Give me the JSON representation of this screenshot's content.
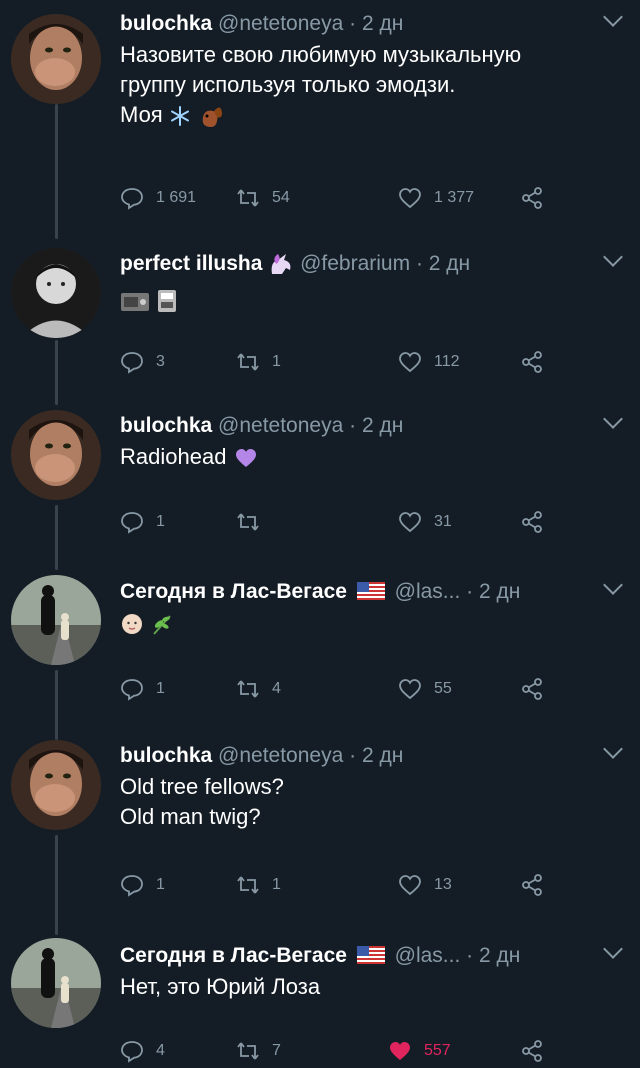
{
  "tweets": [
    {
      "name": "bulochka",
      "handle": "@netetoneya",
      "time": "· 2 дн",
      "lines": [
        "Назовите свою любимую музыкальную",
        "группу используя только эмодзи.",
        "Моя"
      ],
      "replies": "1 691",
      "retweets": "54",
      "likes": "1 377",
      "liked": false
    },
    {
      "name": "perfect illusha",
      "handle": "@febrarium",
      "time": "· 2 дн",
      "lines": [],
      "replies": "3",
      "retweets": "1",
      "likes": "112",
      "liked": false
    },
    {
      "name": "bulochka",
      "handle": "@netetoneya",
      "time": "· 2 дн",
      "lines": [
        "Radiohead"
      ],
      "replies": "1",
      "retweets": "",
      "likes": "31",
      "liked": false
    },
    {
      "name": "Сегодня в Лас-Вегасе",
      "handle": "@las...",
      "time": "· 2 дн",
      "lines": [],
      "replies": "1",
      "retweets": "4",
      "likes": "55",
      "liked": false
    },
    {
      "name": "bulochka",
      "handle": "@netetoneya",
      "time": "· 2 дн",
      "lines": [
        "Old tree fellows?",
        "Old man twig?"
      ],
      "replies": "1",
      "retweets": "1",
      "likes": "13",
      "liked": false
    },
    {
      "name": "Сегодня в Лас-Вегасе",
      "handle": "@las...",
      "time": "· 2 дн",
      "lines": [
        "Нет, это Юрий Лоза"
      ],
      "replies": "4",
      "retweets": "7",
      "likes": "557",
      "liked": true
    }
  ],
  "colors": {
    "background": "#141d26",
    "secondary_text": "#8899a6",
    "like_active": "#e0245e",
    "thread_line": "#38444d"
  },
  "icons": {
    "reply": "reply-icon",
    "retweet": "retweet-icon",
    "like": "heart-icon",
    "share": "share-icon",
    "more": "chevron-down-icon"
  }
}
